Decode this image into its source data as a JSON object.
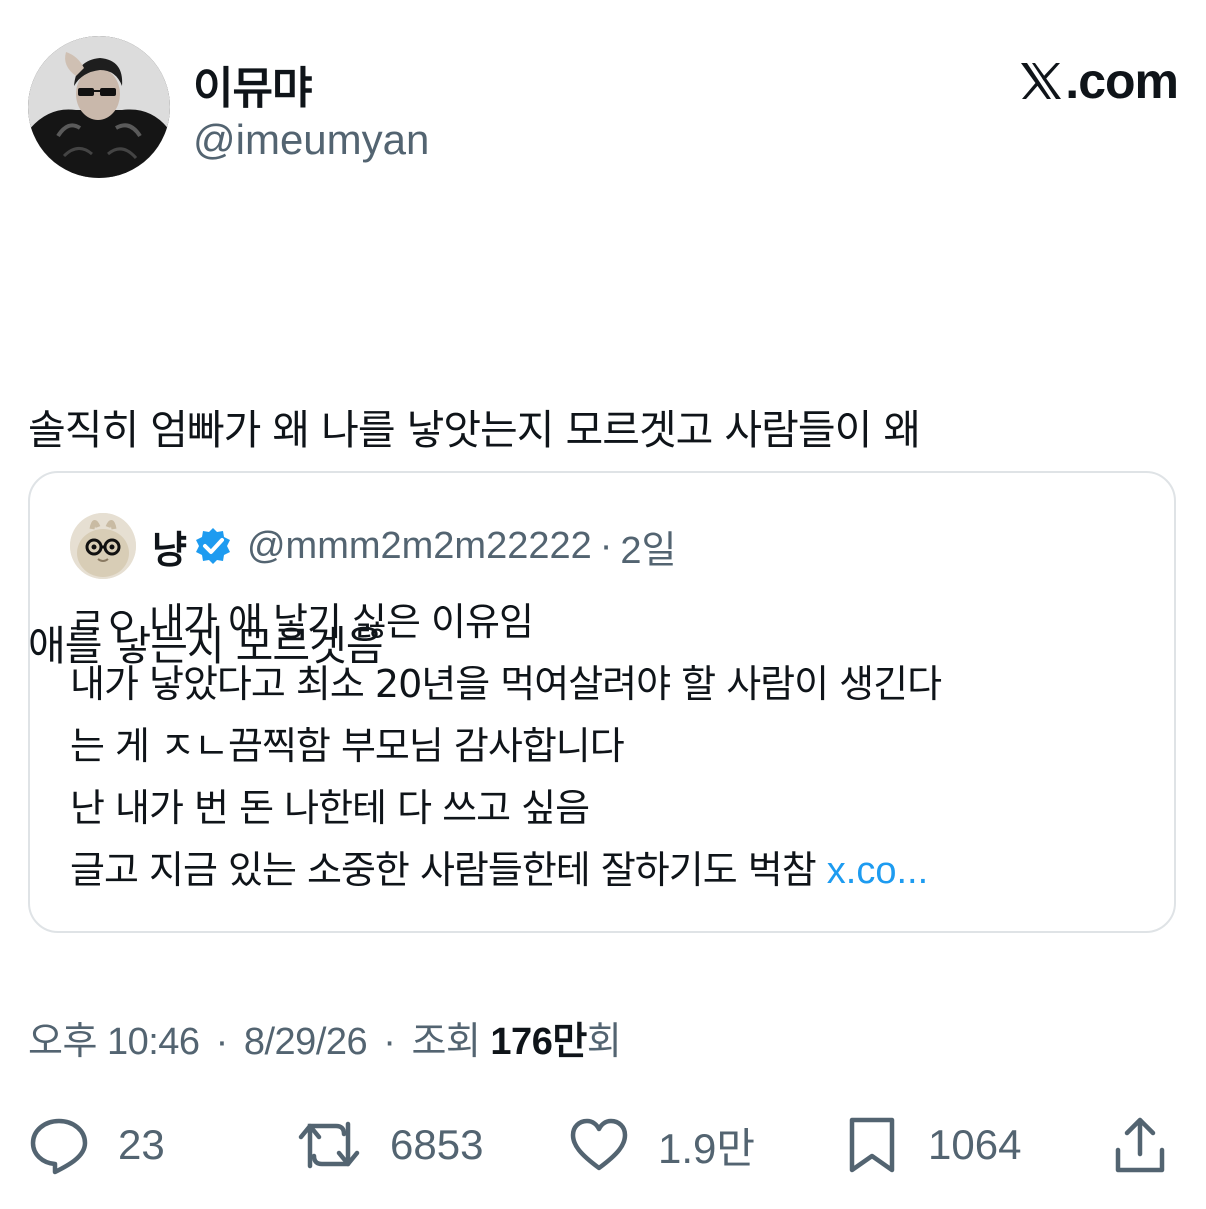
{
  "author": {
    "display_name": "이뮤먀",
    "handle": "@imeumyan"
  },
  "brand": {
    "label": ".com"
  },
  "tweet": {
    "lines": [
      "솔직히 엄빠가 왜 나를 낳앗는지 모르겟고 사람들이 왜",
      "애를 낳는지 모르겟음"
    ]
  },
  "quoted_tweet": {
    "display_name": "냥",
    "handle": "@mmm2m2m22222",
    "separator": "·",
    "time": "2일",
    "lines": [
      "ㄹㅇ 내가 애 낳기 싫은 이유임",
      "내가 낳았다고 최소 20년을 먹여살려야 할 사람이 생긴다",
      "는 게 ㅈㄴ끔찍함 부모님 감사합니다",
      "난 내가 번 돈 나한테 다 쓰고 싶음",
      "글고 지금 있는 소중한 사람들한테 잘하기도 벅참"
    ],
    "more_link": "x.co..."
  },
  "meta": {
    "time": "오후 10:46",
    "separator": "·",
    "date": "8/29/26",
    "views_label": "조회",
    "views_count": "176만",
    "views_suffix": "회"
  },
  "actions": {
    "replies": "23",
    "reposts": "6853",
    "likes": "1.9만",
    "bookmarks": "1064"
  },
  "colors": {
    "text": "#0f1419",
    "secondary": "#536471",
    "link": "#1d9bf0",
    "border": "#dfe3e6"
  }
}
